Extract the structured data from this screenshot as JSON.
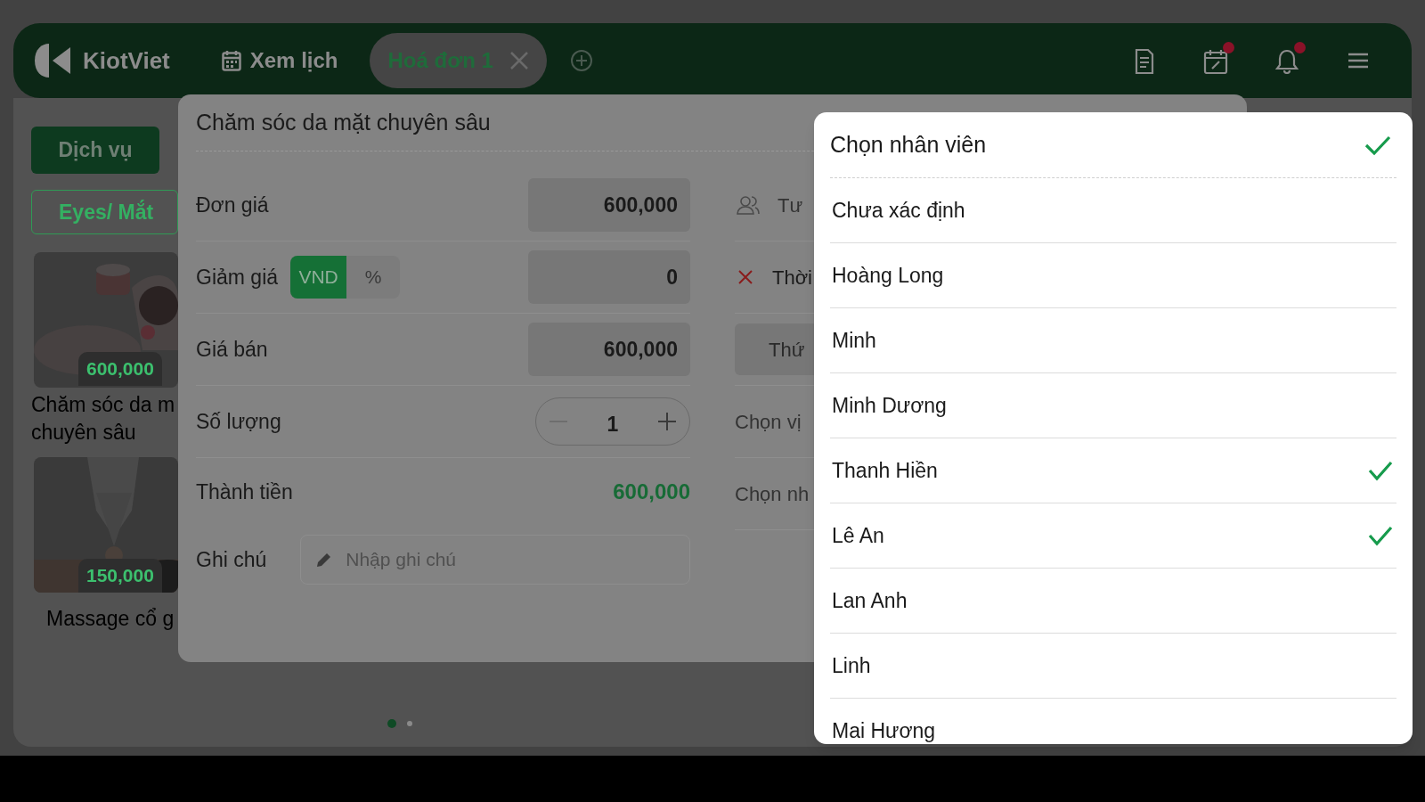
{
  "top_bar": {
    "logo": "KiotViet",
    "nav": [
      {
        "label": "Xem lịch"
      }
    ],
    "tabs": [
      {
        "label": "Hoá đơn 1",
        "selected": true
      }
    ],
    "icons": [
      {
        "kind": "document",
        "badge": false
      },
      {
        "kind": "calendar",
        "badge": true
      },
      {
        "kind": "bell",
        "badge": true
      },
      {
        "kind": "menu",
        "badge": false
      }
    ]
  },
  "left_panel": {
    "categories": [
      {
        "label": "Dịch vụ",
        "selected": true
      }
    ],
    "filters": [
      {
        "label": "Eyes/ Mắt"
      }
    ],
    "products": [
      {
        "price": "600,000",
        "name_lines": [
          "Chăm sóc da m",
          "chuyên sâu"
        ]
      },
      {
        "price": "150,000",
        "name_lines": [
          "Massage cổ g"
        ]
      }
    ],
    "pages": [
      {
        "selected": true
      },
      {
        "selected": false
      }
    ]
  },
  "modal": {
    "title": "Chăm sóc da mặt chuyên sâu",
    "rows": [
      {
        "kind": "input",
        "label": "Đơn giá",
        "value": "600,000"
      },
      {
        "kind": "discount",
        "label": "Giảm giá",
        "units": [
          {
            "label": "VND",
            "selected": true
          },
          {
            "label": "%",
            "selected": false
          }
        ],
        "value": "0"
      },
      {
        "kind": "input",
        "label": "Giá bán",
        "value": "600,000"
      },
      {
        "kind": "stepper",
        "label": "Số lượng",
        "value": "1"
      },
      {
        "kind": "total",
        "label": "Thành tiền",
        "value": "600,000"
      },
      {
        "kind": "note",
        "label": "Ghi chú",
        "placeholder": "Nhập ghi chú"
      }
    ],
    "side_rows": [
      {
        "kind": "people",
        "text": "Tư"
      },
      {
        "kind": "remove",
        "text": "Thời"
      },
      {
        "kind": "box",
        "text": "Thứ"
      },
      {
        "kind": "plain",
        "text": "Chọn vị"
      },
      {
        "kind": "plain",
        "text": "Chọn nh"
      }
    ]
  },
  "staff_picker": {
    "title": "Chọn nhân viên",
    "items": [
      {
        "name": "Chưa xác định",
        "selected": false
      },
      {
        "name": "Hoàng Long",
        "selected": false
      },
      {
        "name": "Minh",
        "selected": false
      },
      {
        "name": "Minh Dương",
        "selected": false
      },
      {
        "name": "Thanh Hiền",
        "selected": true
      },
      {
        "name": "Lê An",
        "selected": true
      },
      {
        "name": "Lan Anh",
        "selected": false
      },
      {
        "name": "Linh",
        "selected": false
      },
      {
        "name": "Mai Hương",
        "selected": false
      }
    ]
  }
}
